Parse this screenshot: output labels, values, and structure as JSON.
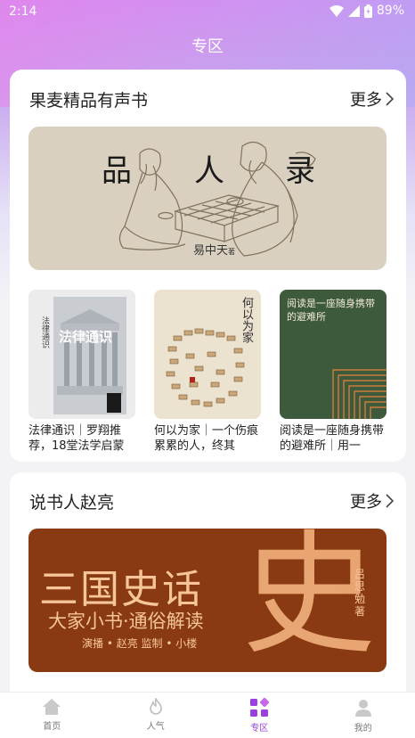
{
  "status_bar": {
    "time": "2:14",
    "battery": "89%"
  },
  "header": {
    "title": "专区"
  },
  "section1": {
    "title": "果麦精品有声书",
    "more": "更多",
    "banner": {
      "title_chars": [
        "品",
        "人",
        "录"
      ],
      "author": "易中天",
      "author_suffix": "著"
    },
    "books": [
      {
        "name": "法律通识｜罗翔推荐，18堂法学启蒙",
        "cover_title": "法律通识"
      },
      {
        "name": "何以为家｜一个伤痕累累的人，终其",
        "cover_title": "何以为家"
      },
      {
        "name": "阅读是一座随身携带的避难所｜用一",
        "cover_title": "阅读是一座随身携带的避难所"
      }
    ]
  },
  "section2": {
    "title": "说书人赵亮",
    "more": "更多",
    "banner": {
      "title": "三国史话",
      "subtitle": "大家小书·通俗解读",
      "credit": "演播 • 赵亮   监制 • 小楼",
      "author": "吕思勉著",
      "big_char": "史"
    }
  },
  "tabbar": {
    "items": [
      {
        "label": "首页",
        "icon": "home-icon"
      },
      {
        "label": "人气",
        "icon": "fire-icon"
      },
      {
        "label": "专区",
        "icon": "grid-icon"
      },
      {
        "label": "我的",
        "icon": "user-icon"
      }
    ],
    "active_index": 2,
    "accent": "#9b3fe0"
  }
}
